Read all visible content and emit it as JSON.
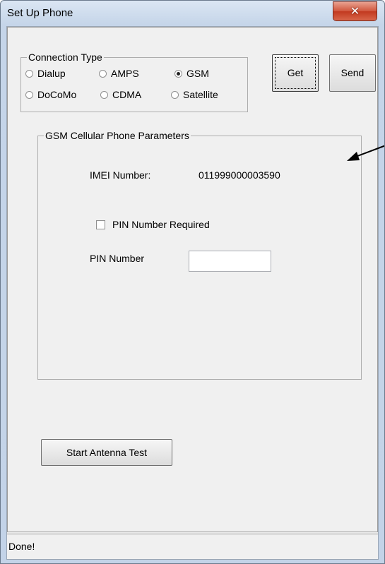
{
  "window": {
    "title": "Set Up Phone"
  },
  "connection_type": {
    "legend": "Connection Type",
    "options": [
      {
        "label": "Dialup",
        "checked": false
      },
      {
        "label": "AMPS",
        "checked": false
      },
      {
        "label": "GSM",
        "checked": true
      },
      {
        "label": "DoCoMo",
        "checked": false
      },
      {
        "label": "CDMA",
        "checked": false
      },
      {
        "label": "Satellite",
        "checked": false
      }
    ]
  },
  "buttons": {
    "get": "Get",
    "send": "Send",
    "antenna_test": "Start Antenna Test"
  },
  "gsm": {
    "legend": "GSM Cellular Phone Parameters",
    "imei_label": "IMEI Number:",
    "imei_value": "011999000003590",
    "pin_required_label": "PIN Number Required",
    "pin_required_checked": false,
    "pin_label": "PIN Number",
    "pin_value": ""
  },
  "status": {
    "text": "Done!"
  },
  "icons": {
    "close": "close-icon",
    "annotation": "arrow-icon"
  }
}
